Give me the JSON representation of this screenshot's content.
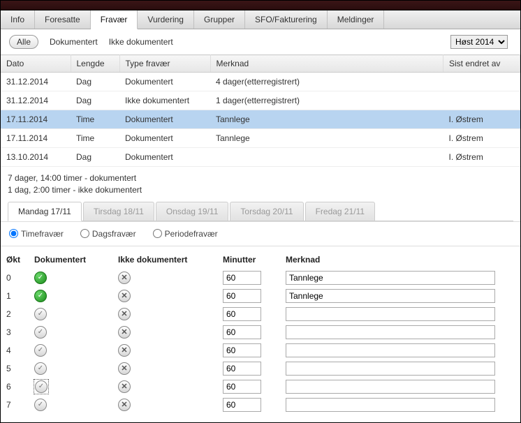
{
  "nav_tabs": [
    "Info",
    "Foresatte",
    "Fravær",
    "Vurdering",
    "Grupper",
    "SFO/Fakturering",
    "Meldinger"
  ],
  "nav_active_index": 2,
  "filters": {
    "all": "Alle",
    "doc": "Dokumentert",
    "notdoc": "Ikke dokumentert"
  },
  "term_options": [
    "Høst 2014"
  ],
  "term_selected": "Høst 2014",
  "table_headers": {
    "dato": "Dato",
    "lengde": "Lengde",
    "type": "Type fravær",
    "merknad": "Merknad",
    "sist": "Sist endret av"
  },
  "rows": [
    {
      "dato": "31.12.2014",
      "lengde": "Dag",
      "type": "Dokumentert",
      "merknad": "4 dager(etterregistrert)",
      "sist": "",
      "selected": false
    },
    {
      "dato": "31.12.2014",
      "lengde": "Dag",
      "type": "Ikke dokumentert",
      "merknad": "1 dager(etterregistrert)",
      "sist": "",
      "selected": false
    },
    {
      "dato": "17.11.2014",
      "lengde": "Time",
      "type": "Dokumentert",
      "merknad": "Tannlege",
      "sist": "I. Østrem",
      "selected": true
    },
    {
      "dato": "17.11.2014",
      "lengde": "Time",
      "type": "Dokumentert",
      "merknad": "Tannlege",
      "sist": "I. Østrem",
      "selected": false
    },
    {
      "dato": "13.10.2014",
      "lengde": "Dag",
      "type": "Dokumentert",
      "merknad": "",
      "sist": "I. Østrem",
      "selected": false
    }
  ],
  "summary": {
    "line1": "7 dager, 14:00 timer - dokumentert",
    "line2": "1 dag, 2:00 timer - ikke dokumentert"
  },
  "day_tabs": [
    "Mandag 17/11",
    "Tirsdag 18/11",
    "Onsdag 19/11",
    "Torsdag 20/11",
    "Fredag 21/11"
  ],
  "day_active_index": 0,
  "radio": {
    "time": "Timefravær",
    "dag": "Dagsfravær",
    "periode": "Periodefravær",
    "selected": "time"
  },
  "okt_headers": {
    "okt": "Økt",
    "dok": "Dokumentert",
    "ikkedok": "Ikke dokumentert",
    "min": "Minutter",
    "merk": "Merknad"
  },
  "okt_rows": [
    {
      "okt": "0",
      "dok": true,
      "min": "60",
      "merk": "Tannlege",
      "focus": false
    },
    {
      "okt": "1",
      "dok": true,
      "min": "60",
      "merk": "Tannlege",
      "focus": false
    },
    {
      "okt": "2",
      "dok": false,
      "min": "60",
      "merk": "",
      "focus": false
    },
    {
      "okt": "3",
      "dok": false,
      "min": "60",
      "merk": "",
      "focus": false
    },
    {
      "okt": "4",
      "dok": false,
      "min": "60",
      "merk": "",
      "focus": false
    },
    {
      "okt": "5",
      "dok": false,
      "min": "60",
      "merk": "",
      "focus": false
    },
    {
      "okt": "6",
      "dok": false,
      "min": "60",
      "merk": "",
      "focus": true
    },
    {
      "okt": "7",
      "dok": false,
      "min": "60",
      "merk": "",
      "focus": false
    }
  ]
}
